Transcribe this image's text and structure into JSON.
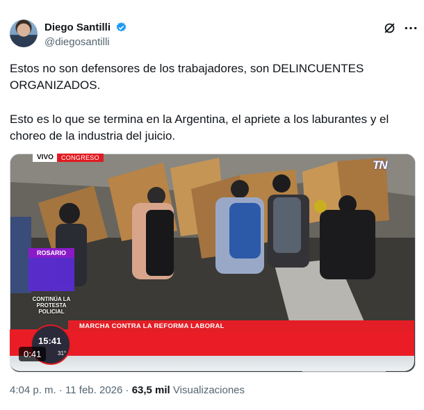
{
  "author": {
    "name": "Diego Santilli",
    "handle": "@diegosantilli",
    "verified_color": "#1d9bf0"
  },
  "post": {
    "paragraph_1": "Estos no son defensores de los trabajadores, son DELINCUENTES ORGANIZADOS.",
    "paragraph_2": "Esto es lo que se termina en la Argentina, el apriete a los laburantes y el choreo de la industria del juicio."
  },
  "video": {
    "live_label": "VIVO",
    "live_location": "CONGRESO",
    "channel_logo": "TN",
    "side_location": "ROSARIO",
    "side_caption": "CONTINÚA LA PROTESTA POLICIAL",
    "headline": "MARCHA CONTRA LA REFORMA LABORAL",
    "clock_time": "15:41",
    "clock_temp": "31°",
    "timecode": "0:41",
    "accent_color": "#e41e26"
  },
  "footer": {
    "time": "4:04 p. m.",
    "separator": "·",
    "date": "11 feb. 2026",
    "views_count": "63,5 mil",
    "views_label": "Visualizaciones"
  },
  "icons": [
    "verified-badge-icon",
    "grok-icon",
    "more-options-icon"
  ]
}
